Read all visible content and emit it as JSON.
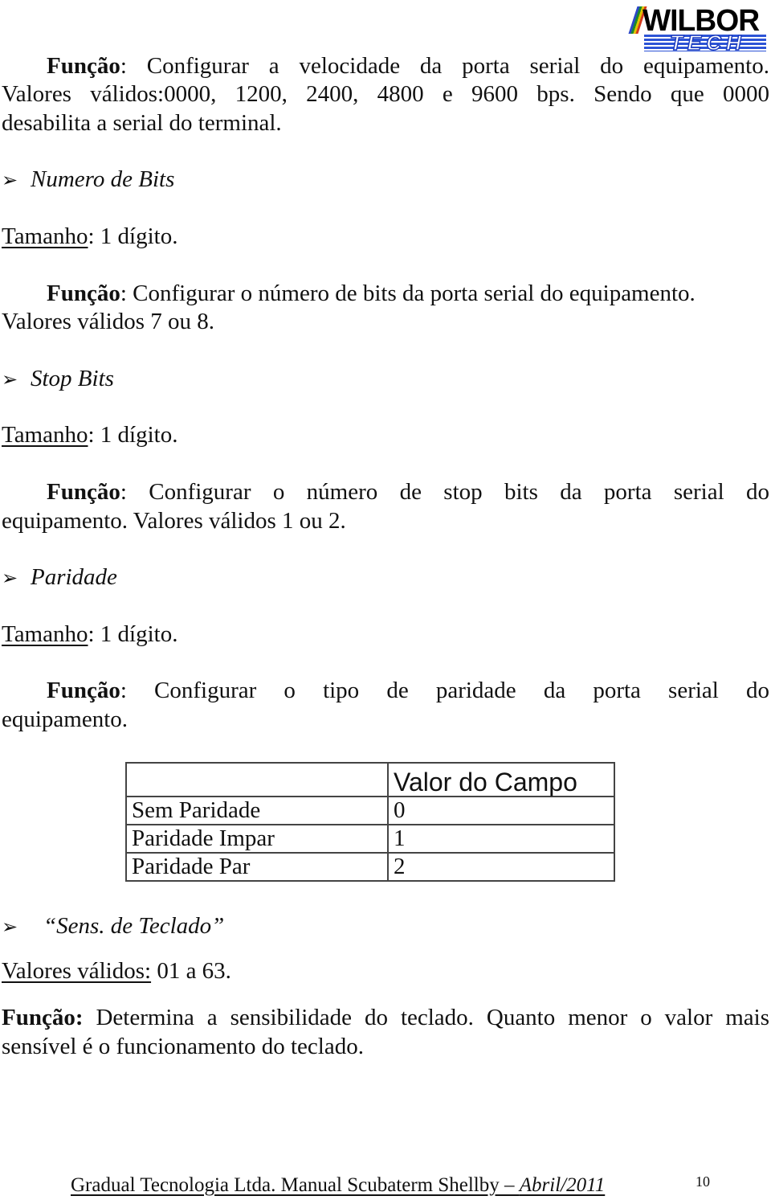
{
  "logo": {
    "top_word": "WILBOR",
    "bottom_word": "TECH"
  },
  "sections": {
    "velocidade": {
      "funcao_label": "Função",
      "funcao_line1": ": Configurar a velocidade da porta serial do equipamento.",
      "line2": "Valores válidos:0000, 1200, 2400, 4800 e 9600 bps.  Sendo que 0000",
      "line3": "desabilita a serial do terminal."
    },
    "numero_bits": {
      "heading": "Numero de Bits",
      "tamanho_label": "Tamanho",
      "tamanho_value": ": 1 dígito.",
      "funcao_label": "Função",
      "funcao_line1": ": Configurar o número de bits da porta serial do equipamento.",
      "line2": "Valores válidos 7 ou 8."
    },
    "stop_bits": {
      "heading": "Stop Bits",
      "tamanho_label": "Tamanho",
      "tamanho_value": ": 1 dígito.",
      "funcao_label": "Função",
      "funcao_line1": ": Configurar o número de stop bits da porta serial do",
      "line2": "equipamento. Valores válidos 1 ou 2."
    },
    "paridade": {
      "heading": "Paridade",
      "tamanho_label": "Tamanho",
      "tamanho_value": ": 1 dígito.",
      "funcao_label": "Função",
      "funcao_line1": ": Configurar o tipo de paridade da porta serial do",
      "line2": "equipamento.",
      "table": {
        "header": [
          "",
          "Valor do Campo"
        ],
        "rows": [
          [
            "Sem Paridade",
            "0"
          ],
          [
            "Paridade Impar",
            "1"
          ],
          [
            "Paridade Par",
            "2"
          ]
        ]
      }
    },
    "sens_teclado": {
      "heading": "“Sens. de Teclado”",
      "valores_label": "Valores válidos:",
      "valores_value": " 01 a 63.",
      "funcao_label": "Função:",
      "funcao_line1": " Determina a sensibilidade do teclado. Quanto menor o valor mais",
      "line2": "sensível é o funcionamento do teclado."
    }
  },
  "footer": {
    "text": "Gradual Tecnologia Ltda. Manual Scubaterm Shellby – ",
    "date": "Abril/2011",
    "page_number": "10"
  }
}
